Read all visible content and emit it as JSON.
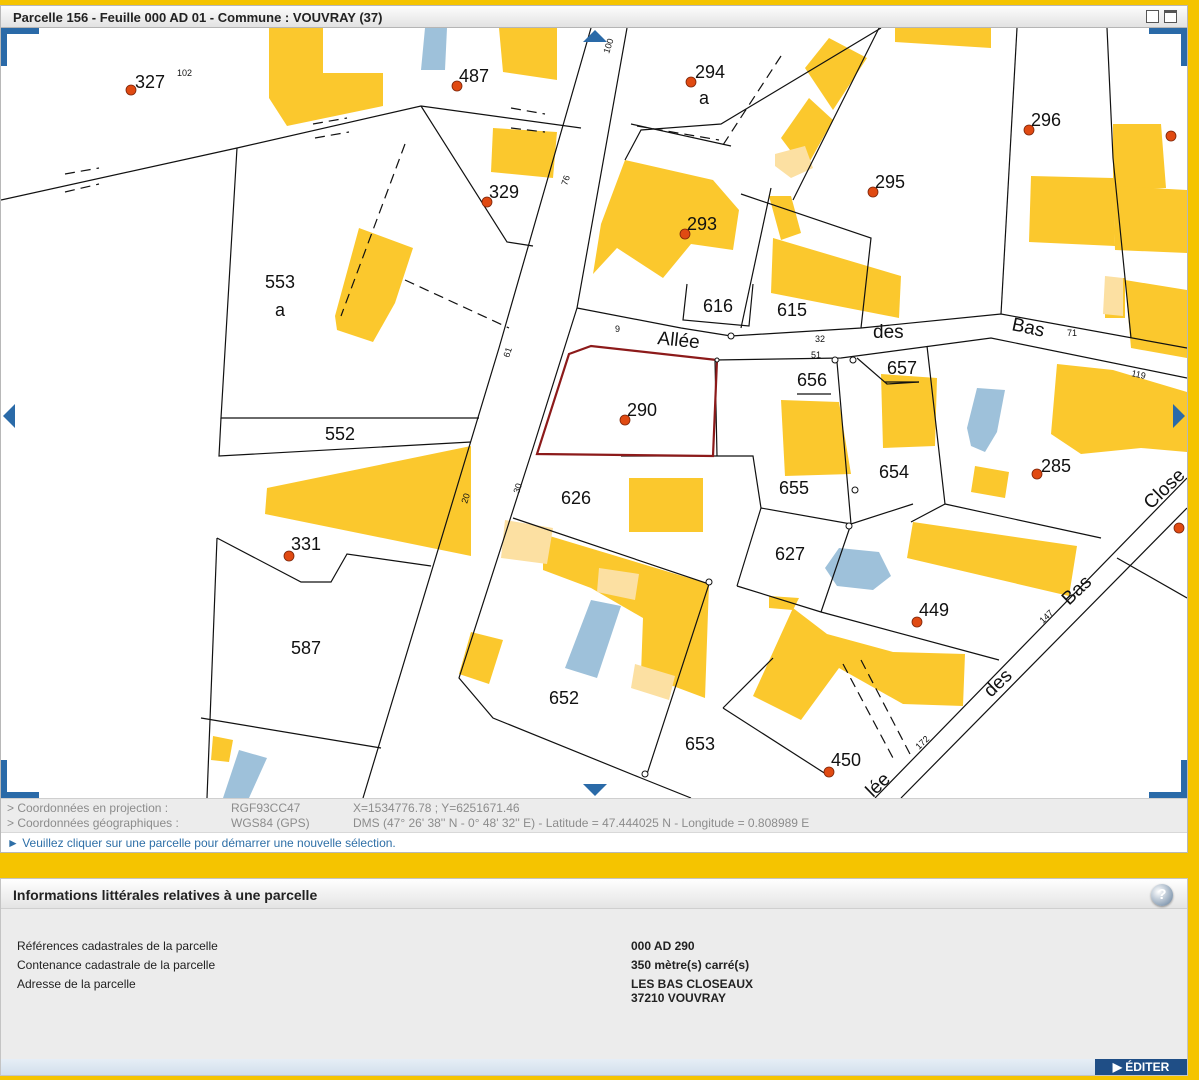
{
  "window": {
    "title": "Parcelle 156 - Feuille 000 AD 01 - Commune : VOUVRAY (37)"
  },
  "map": {
    "selected_parcel": "290",
    "parcels": [
      {
        "label": "327"
      },
      {
        "label": "487"
      },
      {
        "label": "294"
      },
      {
        "label": "a"
      },
      {
        "label": "296"
      },
      {
        "label": "329"
      },
      {
        "label": "295"
      },
      {
        "label": "293"
      },
      {
        "label": "553"
      },
      {
        "label": "a"
      },
      {
        "label": "616"
      },
      {
        "label": "615"
      },
      {
        "label": "656"
      },
      {
        "label": "657"
      },
      {
        "label": "290"
      },
      {
        "label": "552"
      },
      {
        "label": "654"
      },
      {
        "label": "285"
      },
      {
        "label": "626"
      },
      {
        "label": "655"
      },
      {
        "label": "331"
      },
      {
        "label": "627"
      },
      {
        "label": "449"
      },
      {
        "label": "587"
      },
      {
        "label": "652"
      },
      {
        "label": "653"
      },
      {
        "label": "450"
      }
    ],
    "street_labels": [
      "Allée",
      "des",
      "Bas",
      "Close",
      "Bas",
      "des",
      "lée"
    ],
    "small_numbers": [
      "102",
      "100",
      "76",
      "61",
      "30",
      "20",
      "9",
      "32",
      "51",
      "71",
      "119",
      "147",
      "172"
    ],
    "colors": {
      "building": "#fbc82d",
      "building_light": "#fce0a2",
      "water": "#9ec1da",
      "selection": "#8c1a1a",
      "point": "#e04a12",
      "accent": "#2a6aa8"
    }
  },
  "coordinates": {
    "projection_label": "> Coordonnées en projection :",
    "projection_system": "RGF93CC47",
    "projection_value": "X=1534776.78 ; Y=6251671.46",
    "geo_label": "> Coordonnées géographiques :",
    "geo_system": "WGS84 (GPS)",
    "geo_value": "DMS (47° 26' 38'' N - 0° 48' 32'' E) - Latitude = 47.444025 N - Longitude = 0.808989 E"
  },
  "status": "► Veuillez cliquer sur une parcelle pour démarrer une nouvelle sélection.",
  "info": {
    "title": "Informations littérales relatives à une parcelle",
    "help": "?",
    "rows": [
      {
        "label": "Références cadastrales de la parcelle",
        "value": "000 AD 290"
      },
      {
        "label": "Contenance cadastrale de la parcelle",
        "value": "350 mètre(s) carré(s)"
      },
      {
        "label": "Adresse de la parcelle",
        "value": "LES BAS CLOSEAUX",
        "value2": "37210 VOUVRAY"
      }
    ],
    "edit_label": "ÉDITER"
  }
}
